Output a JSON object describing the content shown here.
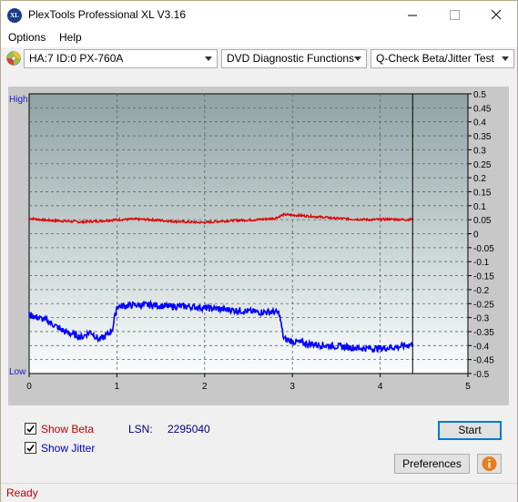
{
  "window": {
    "title": "PlexTools Professional XL V3.16",
    "logo_text": "XL",
    "controls": [
      "minimize-icon",
      "maximize-icon",
      "close-icon"
    ]
  },
  "menu": {
    "options_label": "Options",
    "help_label": "Help"
  },
  "toolbar": {
    "drive": "HA:7 ID:0  PX-760A",
    "function": "DVD Diagnostic Functions",
    "test": "Q-Check Beta/Jitter Test"
  },
  "chart": {
    "high_label": "High",
    "low_label": "Low",
    "y_ticks": [
      "0.5",
      "0.45",
      "0.4",
      "0.35",
      "0.3",
      "0.25",
      "0.2",
      "0.15",
      "0.1",
      "0.05",
      "0",
      "-0.05",
      "-0.1",
      "-0.15",
      "-0.2",
      "-0.25",
      "-0.3",
      "-0.35",
      "-0.4",
      "-0.45",
      "-0.5"
    ],
    "x_ticks": [
      "0",
      "1",
      "2",
      "3",
      "4",
      "5"
    ]
  },
  "chart_data": {
    "type": "line",
    "xlim": [
      0,
      5
    ],
    "ylim": [
      -0.5,
      0.5
    ],
    "grid": true,
    "cursor_x": 4.37,
    "series": [
      {
        "name": "Beta",
        "color": "#e00000",
        "x": [
          0,
          0.2,
          0.4,
          0.6,
          0.8,
          1.0,
          1.2,
          1.4,
          1.6,
          1.8,
          2.0,
          2.2,
          2.4,
          2.6,
          2.8,
          2.9,
          3.1,
          3.3,
          3.5,
          3.7,
          3.9,
          4.1,
          4.3,
          4.37
        ],
        "y": [
          0.055,
          0.048,
          0.045,
          0.042,
          0.045,
          0.05,
          0.052,
          0.05,
          0.045,
          0.042,
          0.04,
          0.045,
          0.048,
          0.05,
          0.055,
          0.068,
          0.065,
          0.06,
          0.055,
          0.052,
          0.05,
          0.052,
          0.05,
          0.052
        ]
      },
      {
        "name": "Jitter",
        "color": "#0000ff",
        "x": [
          0,
          0.1,
          0.2,
          0.3,
          0.4,
          0.5,
          0.6,
          0.7,
          0.8,
          0.9,
          0.95,
          1.0,
          1.2,
          1.4,
          1.6,
          1.8,
          2.0,
          2.2,
          2.4,
          2.6,
          2.8,
          2.85,
          2.9,
          3.0,
          3.2,
          3.4,
          3.6,
          3.8,
          4.0,
          4.2,
          4.37
        ],
        "y": [
          -0.29,
          -0.3,
          -0.31,
          -0.33,
          -0.35,
          -0.36,
          -0.37,
          -0.35,
          -0.38,
          -0.36,
          -0.34,
          -0.26,
          -0.255,
          -0.255,
          -0.26,
          -0.26,
          -0.265,
          -0.27,
          -0.275,
          -0.28,
          -0.28,
          -0.285,
          -0.375,
          -0.385,
          -0.395,
          -0.4,
          -0.405,
          -0.41,
          -0.41,
          -0.405,
          -0.395
        ]
      }
    ]
  },
  "bottom": {
    "show_beta": "Show Beta",
    "show_jitter": "Show Jitter",
    "lsn_label": "LSN:",
    "lsn_value": "2295040",
    "start_label": "Start",
    "preferences_label": "Preferences",
    "beta_color": "#c00000",
    "jitter_color": "#0000c0"
  },
  "status": {
    "text": "Ready"
  }
}
